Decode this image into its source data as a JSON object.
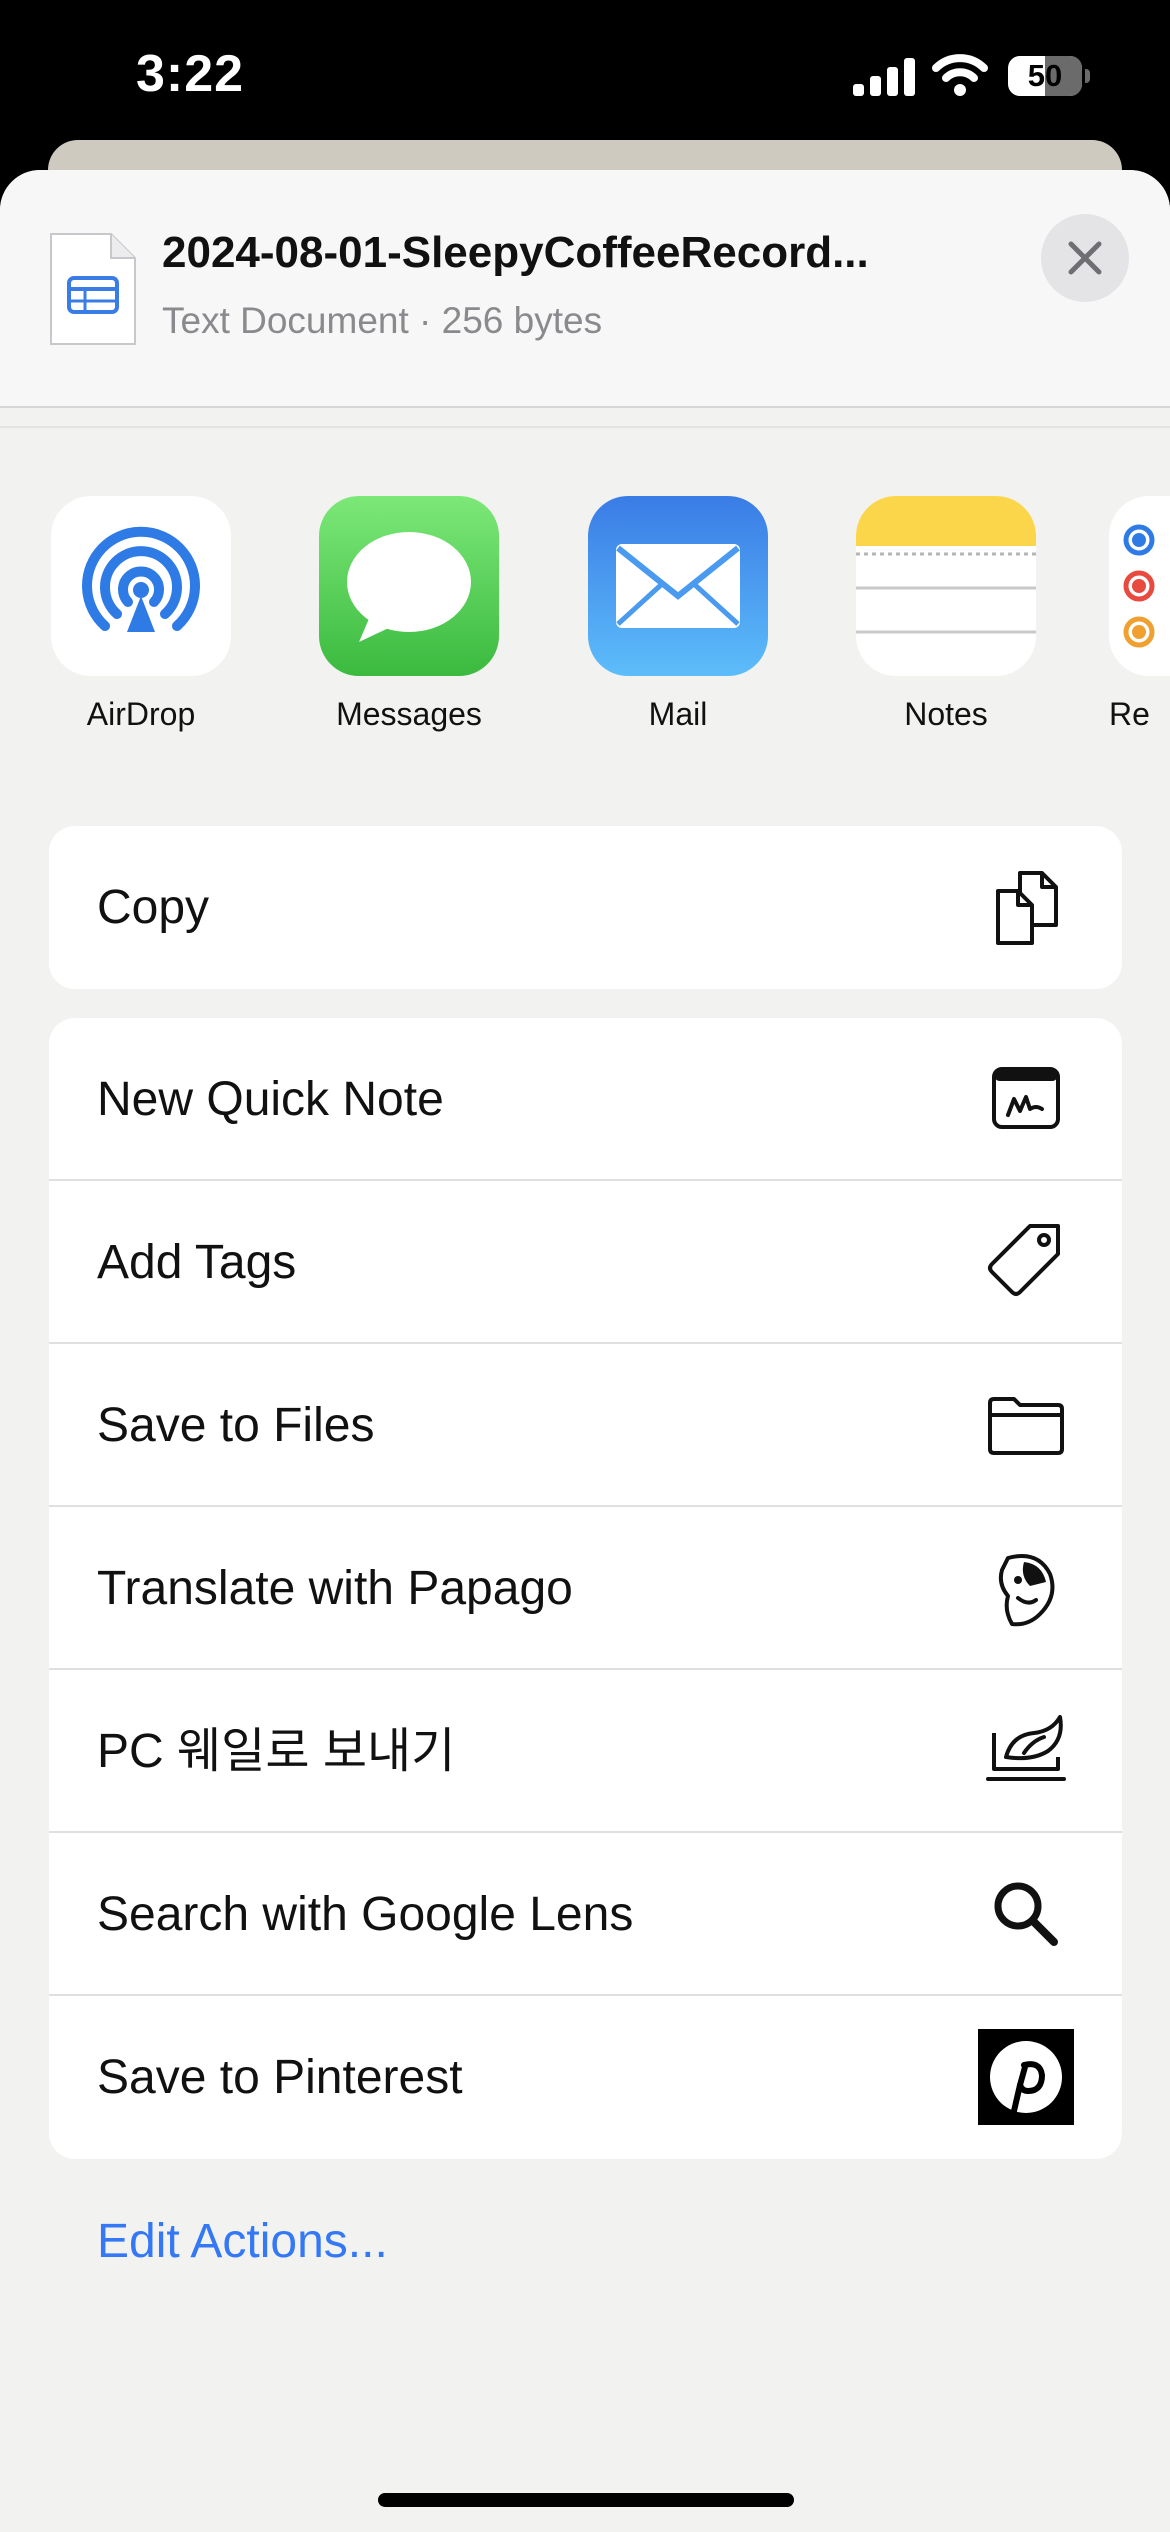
{
  "status_bar": {
    "time": "3:22",
    "battery_level": "50"
  },
  "share_sheet": {
    "file": {
      "title": "2024-08-01-SleepyCoffeeRecord...",
      "subtitle": "Text Document · 256 bytes"
    },
    "apps": [
      {
        "label": "AirDrop",
        "icon": "airdrop-icon"
      },
      {
        "label": "Messages",
        "icon": "messages-icon"
      },
      {
        "label": "Mail",
        "icon": "mail-icon"
      },
      {
        "label": "Notes",
        "icon": "notes-icon"
      },
      {
        "label": "Re",
        "icon": "reminders-icon"
      }
    ],
    "copy_group": [
      {
        "label": "Copy",
        "icon": "copy-icon"
      }
    ],
    "actions": [
      {
        "label": "New Quick Note",
        "icon": "quick-note-icon"
      },
      {
        "label": "Add Tags",
        "icon": "tag-icon"
      },
      {
        "label": "Save to Files",
        "icon": "folder-icon"
      },
      {
        "label": "Translate with Papago",
        "icon": "papago-icon"
      },
      {
        "label": "PC 웨일로 보내기",
        "icon": "whale-icon"
      },
      {
        "label": "Search with Google Lens",
        "icon": "search-icon"
      },
      {
        "label": "Save to Pinterest",
        "icon": "pinterest-icon"
      }
    ],
    "edit_actions_label": "Edit Actions..."
  },
  "colors": {
    "accent": "#3478f6",
    "sheet_background": "#f2f2f1",
    "row_background": "#ffffff"
  }
}
